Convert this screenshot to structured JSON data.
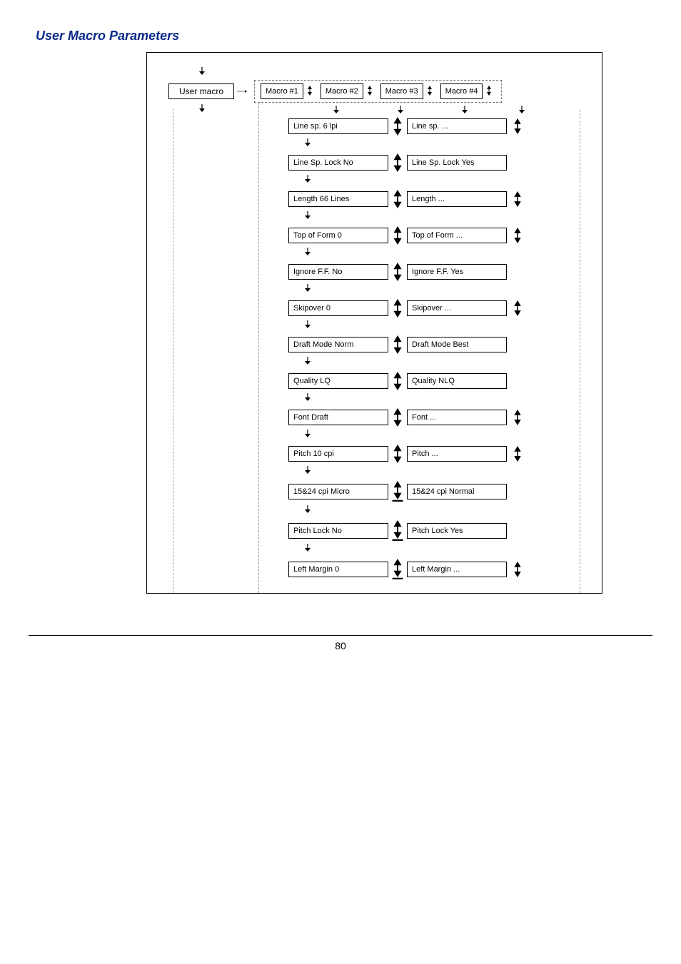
{
  "title": "User Macro Parameters",
  "page_number": "80",
  "user_macro_label": "User macro",
  "macros": [
    "Macro #1",
    "Macro #2",
    "Macro #3",
    "Macro #4"
  ],
  "rows": [
    {
      "left": "Line sp. 6 lpi",
      "right": "Line sp. ...",
      "trail_updown": true,
      "down_after": true
    },
    {
      "left": "Line Sp. Lock No",
      "right": "Line Sp. Lock Yes",
      "trail_updown": false,
      "down_after": true
    },
    {
      "left": "Length 66  Lines",
      "right": "Length ...",
      "trail_updown": true,
      "down_after": true
    },
    {
      "left": "Top of Form 0",
      "right": "Top of Form ...",
      "trail_updown": true,
      "down_after": true
    },
    {
      "left": "Ignore F.F. No",
      "right": "Ignore F.F. Yes",
      "trail_updown": false,
      "down_after": true
    },
    {
      "left": "Skipover 0",
      "right": "Skipover ...",
      "trail_updown": true,
      "down_after": true
    },
    {
      "left": "Draft Mode Norm",
      "right": "Draft Mode Best",
      "trail_updown": false,
      "down_after": true
    },
    {
      "left": "Quality LQ",
      "right": "Quality NLQ",
      "trail_updown": false,
      "down_after": true
    },
    {
      "left": "Font Draft",
      "right": "Font ...",
      "trail_updown": true,
      "down_after": true
    },
    {
      "left": "Pitch 10  cpi",
      "right": "Pitch ...",
      "trail_updown": true,
      "down_after": true
    },
    {
      "left": "15&24 cpi Micro",
      "right": "15&24 cpi Normal",
      "trail_updown": false,
      "down_after": true
    },
    {
      "left": "Pitch Lock No",
      "right": "Pitch Lock Yes",
      "trail_updown": false,
      "down_after": true
    },
    {
      "left": "Left Margin 0",
      "right": "Left Margin ...",
      "trail_updown": true,
      "down_after": false
    }
  ]
}
